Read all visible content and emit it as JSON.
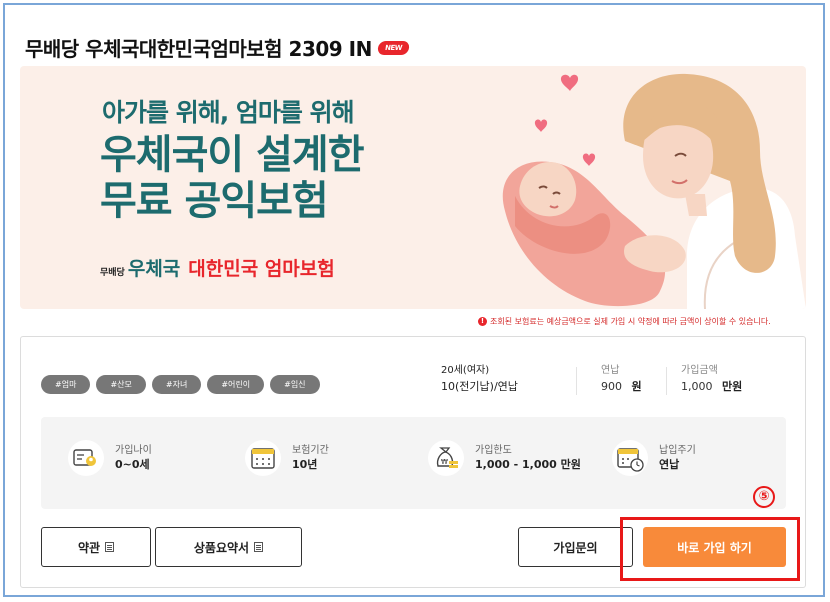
{
  "product": {
    "title": "무배당 우체국대한민국엄마보험 2309 IN",
    "new_badge": "NEW"
  },
  "banner": {
    "subtitle": "아가를 위해, 엄마를 위해",
    "headline_line1": "우체국이 설계한",
    "headline_line2": "무료 공익보험",
    "brand_prefix": "무배당",
    "brand_org": "우체국",
    "brand_product": "대한민국 엄마보험"
  },
  "notice": {
    "icon": "!",
    "text": "조회된 보험료는 예상금액으로 실제 가입 시 약정에 따라 금액이 상이할 수 있습니다."
  },
  "tags": [
    "#엄마",
    "#산모",
    "#자녀",
    "#어린이",
    "#임신"
  ],
  "summary": {
    "age_gender": "20세(여자)",
    "payment_term": "10(전기납)/연납",
    "annual_label": "연납",
    "annual_value": "900",
    "annual_unit": "원",
    "coverage_label": "가입금액",
    "coverage_value": "1,000",
    "coverage_unit": "만원"
  },
  "info": {
    "join_age_label": "가입나이",
    "join_age_value": "0~0세",
    "insurance_period_label": "보험기간",
    "insurance_period_value": "10년",
    "join_limit_label": "가입한도",
    "join_limit_value": "1,000 - 1,000 만원",
    "payment_cycle_label": "납입주기",
    "payment_cycle_value": "연납"
  },
  "buttons": {
    "terms": "약관",
    "product_summary": "상품요약서",
    "inquiry": "가입문의",
    "apply": "바로 가입 하기"
  },
  "annotation": {
    "step": "⑤"
  },
  "colors": {
    "brand_teal": "#1d6b6e",
    "accent_red": "#e8262c",
    "apply_orange": "#f88a3a",
    "banner_bg": "#fcefe8",
    "highlight_red": "#e81818"
  }
}
